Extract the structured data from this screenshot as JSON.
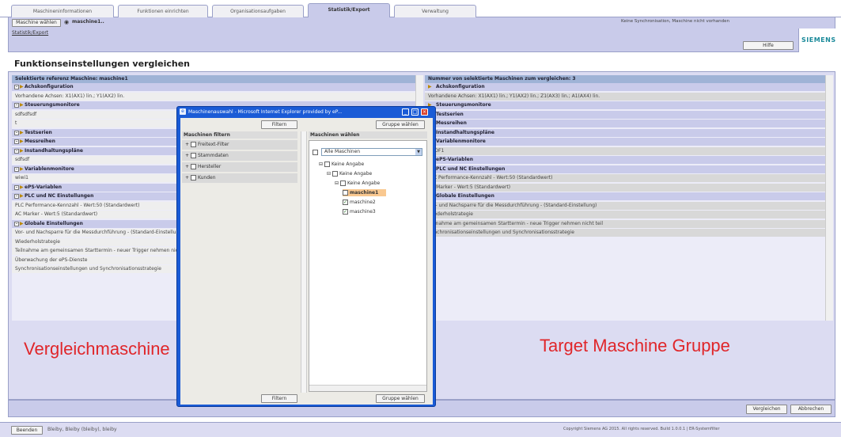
{
  "tabs": [
    "Maschineninformationen",
    "Funktionen einrichten",
    "Organisationsaufgaben",
    "Statistik/Export",
    "Verwaltung"
  ],
  "active_tab_index": 3,
  "toolbar": {
    "machine_select_label": "Maschine wählen",
    "machine_name": "maschine1.."
  },
  "status_message": "Keine Synchronisation, Maschine nicht vorhanden",
  "brand": "SIEMENS",
  "breadcrumb": "Statistik/Export",
  "help_label": "Hilfe",
  "page_title": "Funktionseinstellungen vergleichen",
  "left_panel": {
    "header": "Selektierte referenz Maschine: maschine1",
    "rows": [
      {
        "type": "sec",
        "text": "Achskonfiguration"
      },
      {
        "type": "item",
        "text": "Vorhandene Achsen: X1(AX1) lin.; Y1(AX2) lin."
      },
      {
        "type": "sec",
        "text": "Steuerungsmonitore"
      },
      {
        "type": "item",
        "text": "sdfsdfsdf"
      },
      {
        "type": "item",
        "text": "t"
      },
      {
        "type": "sec",
        "text": "Testserien"
      },
      {
        "type": "sec",
        "text": "Messreihen"
      },
      {
        "type": "sec",
        "text": "Instandhaltungspläne"
      },
      {
        "type": "item",
        "text": "sdfsdf"
      },
      {
        "type": "sec",
        "text": "Variablenmonitore"
      },
      {
        "type": "item",
        "text": "wiwi1"
      },
      {
        "type": "sec",
        "text": "ePS-Variablen"
      },
      {
        "type": "sec",
        "text": "PLC und NC Einstellungen"
      },
      {
        "type": "item",
        "text": "PLC Performance-Kennzahl - Wert:50 (Standardwert)"
      },
      {
        "type": "item",
        "text": "AC Marker - Wert:5 (Standardwert)"
      },
      {
        "type": "sec",
        "text": "Globale Einstellungen"
      },
      {
        "type": "item",
        "text": "Vor- und Nachsparre für die Messdurchführung - (Standard-Einstellung)"
      },
      {
        "type": "item",
        "text": "Wiederholstrategie"
      },
      {
        "type": "item",
        "text": "Teilnahme am gemeinsamen Starttermin - neuer Trigger nehmen nicht teil"
      },
      {
        "type": "item",
        "text": "Überwachung der ePS-Dienste"
      },
      {
        "type": "item",
        "text": "Synchronisationseinstellungen und Synchronisationsstrategie"
      }
    ]
  },
  "right_panel": {
    "header": "Nummer von selektierte Maschinen zum vergleichen: 3",
    "rows": [
      {
        "type": "sec",
        "text": "Achskonfiguration"
      },
      {
        "type": "item",
        "text": "Vorhandene Achsen: X1(AX1) lin.; Y1(AX2) lin.; Z1(AX3) lin.; A1(AX4) lin."
      },
      {
        "type": "sec",
        "text": "Steuerungsmonitore"
      },
      {
        "type": "sec",
        "text": "Testserien"
      },
      {
        "type": "sec",
        "text": "Messreihen"
      },
      {
        "type": "sec",
        "text": "Instandhaltungspläne"
      },
      {
        "type": "sec",
        "text": "Variablenmonitore"
      },
      {
        "type": "item",
        "text": "VROF1"
      },
      {
        "type": "sec",
        "text": "ePS-Variablen"
      },
      {
        "type": "sec",
        "text": "PLC und NC Einstellungen"
      },
      {
        "type": "item",
        "text": "PLC Performance-Kennzahl - Wert:50 (Standardwert)"
      },
      {
        "type": "item",
        "text": "AC Marker - Wert:5 (Standardwert)"
      },
      {
        "type": "sec",
        "text": "Globale Einstellungen"
      },
      {
        "type": "item",
        "text": "Vor- und Nachsparre für die Messdurchführung - (Standard-Einstellung)"
      },
      {
        "type": "item",
        "text": "Wiederholstrategie"
      },
      {
        "type": "item",
        "text": "Teilnahme am gemeinsamen Starttermin - neue Trigger nehmen nicht teil"
      },
      {
        "type": "item",
        "text": "Synchronisationseinstellungen und Synchronisationsstrategie"
      }
    ]
  },
  "annotation_left": "Vergleichmaschine",
  "annotation_right": "Target Maschine Gruppe",
  "dialog": {
    "title": "Maschinenauswahl - Microsoft Internet Explorer provided by eP...",
    "filter_button": "Filtern",
    "group_button": "Gruppe wählen",
    "filter_header": "Maschinen filtern",
    "choose_header": "Maschinen wählen",
    "filters": [
      "Freitext-Filter",
      "Stammdaten",
      "Hersteller",
      "Kunden"
    ],
    "select_value": "Alle Maschinen",
    "tree": [
      "Keine Angabe",
      "Keine Angabe",
      "Keine Angabe",
      "maschine1",
      "maschine2",
      "maschine3"
    ]
  },
  "bottom_buttons": {
    "compare": "Vergleichen",
    "cancel": "Abbrechen"
  },
  "statusbar": {
    "logout": "Beenden",
    "user": "Bleiby, Bleiby (bleiby), bleiby",
    "copyright": "Copyright Siemens AG 2015. All rights reserved. Build 1.0.0.1 | ER-Systemfilter"
  },
  "colors": {
    "accent": "#c9cbea",
    "header": "#9fb3d6",
    "annotation": "#e0262a",
    "dialog_frame": "#1a5bd6"
  }
}
